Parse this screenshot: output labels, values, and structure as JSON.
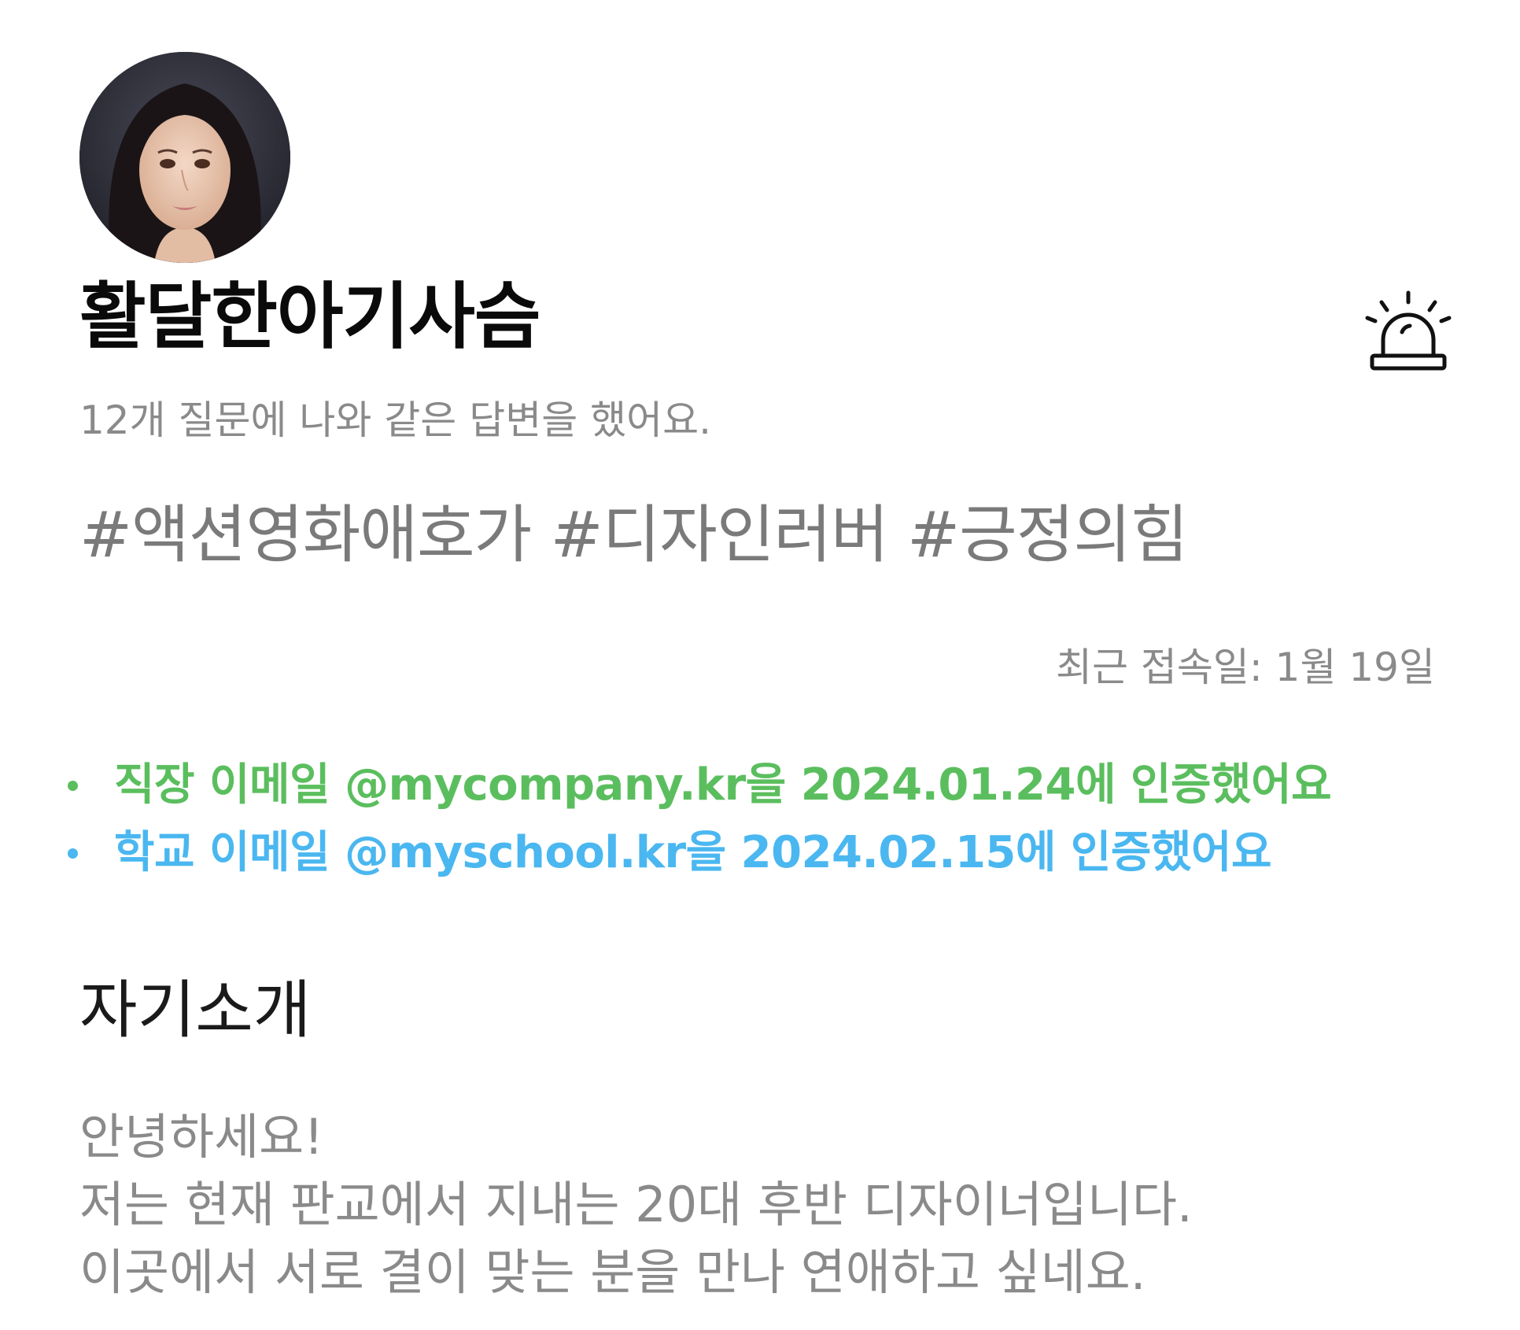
{
  "profile": {
    "avatar_icon": "profile-photo",
    "name": "활달한아기사슴",
    "match_text": "12개 질문에 나와 같은 답변을 했어요.",
    "tags": "#액션영화애호가 #디자인러버 #긍정의힘",
    "last_login": "최근 접속일: 1월 19일",
    "report_icon": "siren-icon"
  },
  "verifications": [
    {
      "text": "직장 이메일 @mycompany.kr을 2024.01.24에 인증했어요",
      "color": "#5bbe5e"
    },
    {
      "text": "학교 이메일 @myschool.kr을 2024.02.15에 인증했어요",
      "color": "#4ab7f0"
    }
  ],
  "intro": {
    "title": "자기소개",
    "lines": [
      "안녕하세요!",
      "저는 현재 판교에서 지내는 20대 후반 디자이너입니다.",
      "이곳에서 서로 결이 맞는 분을 만나 연애하고 싶네요."
    ]
  }
}
